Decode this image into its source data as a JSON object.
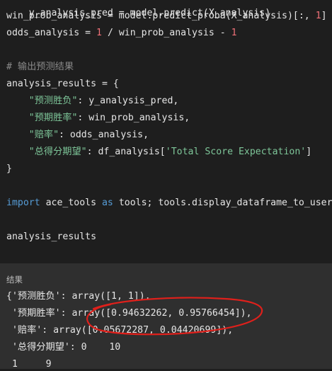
{
  "code": {
    "line0": "y_analysis_pred = model.predict(X_analysis)",
    "line1_a": "win_prob_analysis = model.predict_proba(X_analysis)[:, ",
    "line1_num": "1",
    "line1_b": "]",
    "line2_a": "odds_analysis = ",
    "line2_num1": "1",
    "line2_b": " / win_prob_analysis - ",
    "line2_num2": "1",
    "comment": "# 输出预测结果",
    "results_open": "analysis_results = {",
    "k1": "\"预测胜负\"",
    "v1": ": y_analysis_pred,",
    "k2": "\"预期胜率\"",
    "v2": ": win_prob_analysis,",
    "k3": "\"赔率\"",
    "v3": ": odds_analysis,",
    "k4": "\"总得分期望\"",
    "v4_a": ": df_analysis[",
    "v4_str": "'Total Score Expectation'",
    "v4_b": "]",
    "close": "}",
    "import_kw": "import",
    "import_mod": " ace_tools ",
    "as_kw": "as",
    "import_rest": " tools; tools.display_dataframe_to_user(n",
    "last": "analysis_results"
  },
  "output": {
    "label": "结果",
    "lines": [
      "{'预测胜负': array([1, 1]),",
      " '预期胜率': array([0.94632262, 0.95766454]),",
      " '赔率': array([0.05672287, 0.04420699]),",
      " '总得分期望': 0    10",
      " 1     9"
    ]
  },
  "colors": {
    "keyword": "#569cd6",
    "number": "#f07178",
    "string": "#7ec699",
    "comment": "#8a8a8a",
    "annotation": "#e0201b"
  }
}
